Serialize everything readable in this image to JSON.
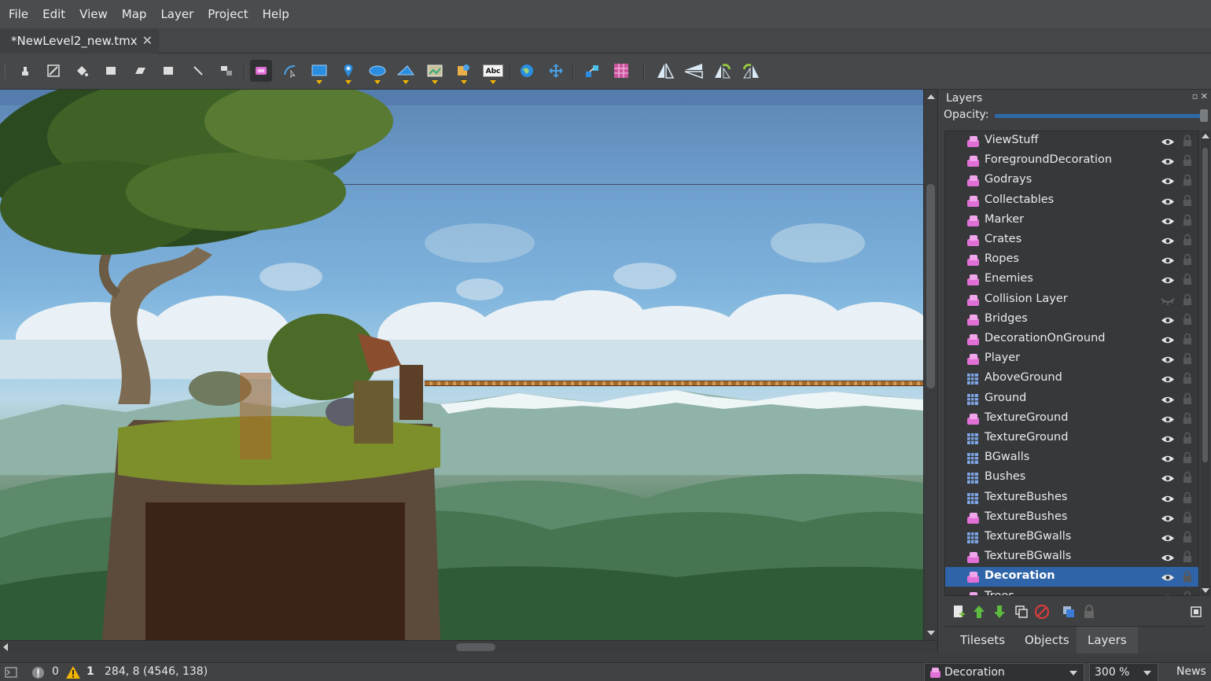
{
  "menu": [
    "File",
    "Edit",
    "View",
    "Map",
    "Layer",
    "Project",
    "Help"
  ],
  "document_tab": {
    "title": "*NewLevel2_new.tmx",
    "close": "✕"
  },
  "toolbar": {
    "tools": [
      "stamp-brush",
      "terrain-brush",
      "bucket-fill",
      "shape-fill",
      "eraser",
      "rectangular-select",
      "magic-wand",
      "select-same-tile",
      "select-objects",
      "edit-polygons",
      "insert-rectangle",
      "insert-point",
      "insert-ellipse",
      "insert-polygon",
      "insert-tile",
      "insert-template",
      "insert-text",
      "world-tool",
      "move-tool",
      "random-mode",
      "wang-fill-mode",
      "flip-horizontal",
      "flip-vertical",
      "rotate-left",
      "rotate-right"
    ],
    "text_tool_label": "Abc"
  },
  "layers_panel": {
    "title": "Layers",
    "opacity_label": "Opacity:",
    "opacity_value": 1.0,
    "layers": [
      {
        "name": "ViewStuff",
        "type": "object",
        "visible": true
      },
      {
        "name": "ForegroundDecoration",
        "type": "object",
        "visible": true
      },
      {
        "name": "Godrays",
        "type": "object",
        "visible": true
      },
      {
        "name": "Collectables",
        "type": "object",
        "visible": true
      },
      {
        "name": "Marker",
        "type": "object",
        "visible": true
      },
      {
        "name": "Crates",
        "type": "object",
        "visible": true
      },
      {
        "name": "Ropes",
        "type": "object",
        "visible": true
      },
      {
        "name": "Enemies",
        "type": "object",
        "visible": true
      },
      {
        "name": "Collision Layer",
        "type": "object",
        "visible": false
      },
      {
        "name": "Bridges",
        "type": "object",
        "visible": true
      },
      {
        "name": "DecorationOnGround",
        "type": "object",
        "visible": true
      },
      {
        "name": "Player",
        "type": "object",
        "visible": true
      },
      {
        "name": "AboveGround",
        "type": "tile",
        "visible": true
      },
      {
        "name": "Ground",
        "type": "tile",
        "visible": true
      },
      {
        "name": "TextureGround",
        "type": "object",
        "visible": true
      },
      {
        "name": "TextureGround",
        "type": "tile",
        "visible": true
      },
      {
        "name": "BGwalls",
        "type": "tile",
        "visible": true
      },
      {
        "name": "Bushes",
        "type": "tile",
        "visible": true
      },
      {
        "name": "TextureBushes",
        "type": "tile",
        "visible": true
      },
      {
        "name": "TextureBushes",
        "type": "object",
        "visible": true
      },
      {
        "name": "TextureBGwalls",
        "type": "tile",
        "visible": true
      },
      {
        "name": "TextureBGwalls",
        "type": "object",
        "visible": true
      },
      {
        "name": "Decoration",
        "type": "object",
        "visible": true,
        "selected": true
      },
      {
        "name": "Trees",
        "type": "object",
        "visible": true
      }
    ],
    "tabs": [
      "Tilesets",
      "Objects",
      "Layers"
    ],
    "active_tab": "Layers"
  },
  "status": {
    "errors": "0",
    "warnings": "1",
    "coordinates": "284, 8 (4546, 138)",
    "current_layer": "Decoration",
    "zoom": "300 %",
    "news": "News"
  },
  "colors": {
    "selection": "#2f65a8",
    "object_layer_icon": "#e06fd6",
    "tile_layer_icon": "#7fa6e6",
    "warning": "#f1b400"
  }
}
